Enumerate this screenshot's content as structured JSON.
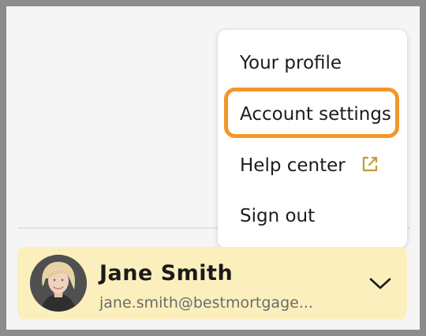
{
  "menu": {
    "items": [
      {
        "label": "Your profile"
      },
      {
        "label": "Account settings"
      },
      {
        "label": "Help center",
        "icon": "external-link-icon"
      },
      {
        "label": "Sign out"
      }
    ],
    "focused_item": "Account settings",
    "focus_color": "#f2972b",
    "external_icon_color": "#c39a37"
  },
  "user": {
    "name": "Jane Smith",
    "email": "jane.smith@bestmortgage...",
    "avatar_icon": "user-photo",
    "expand_icon": "chevron-down-icon",
    "card_color": "#fbf0bd"
  }
}
